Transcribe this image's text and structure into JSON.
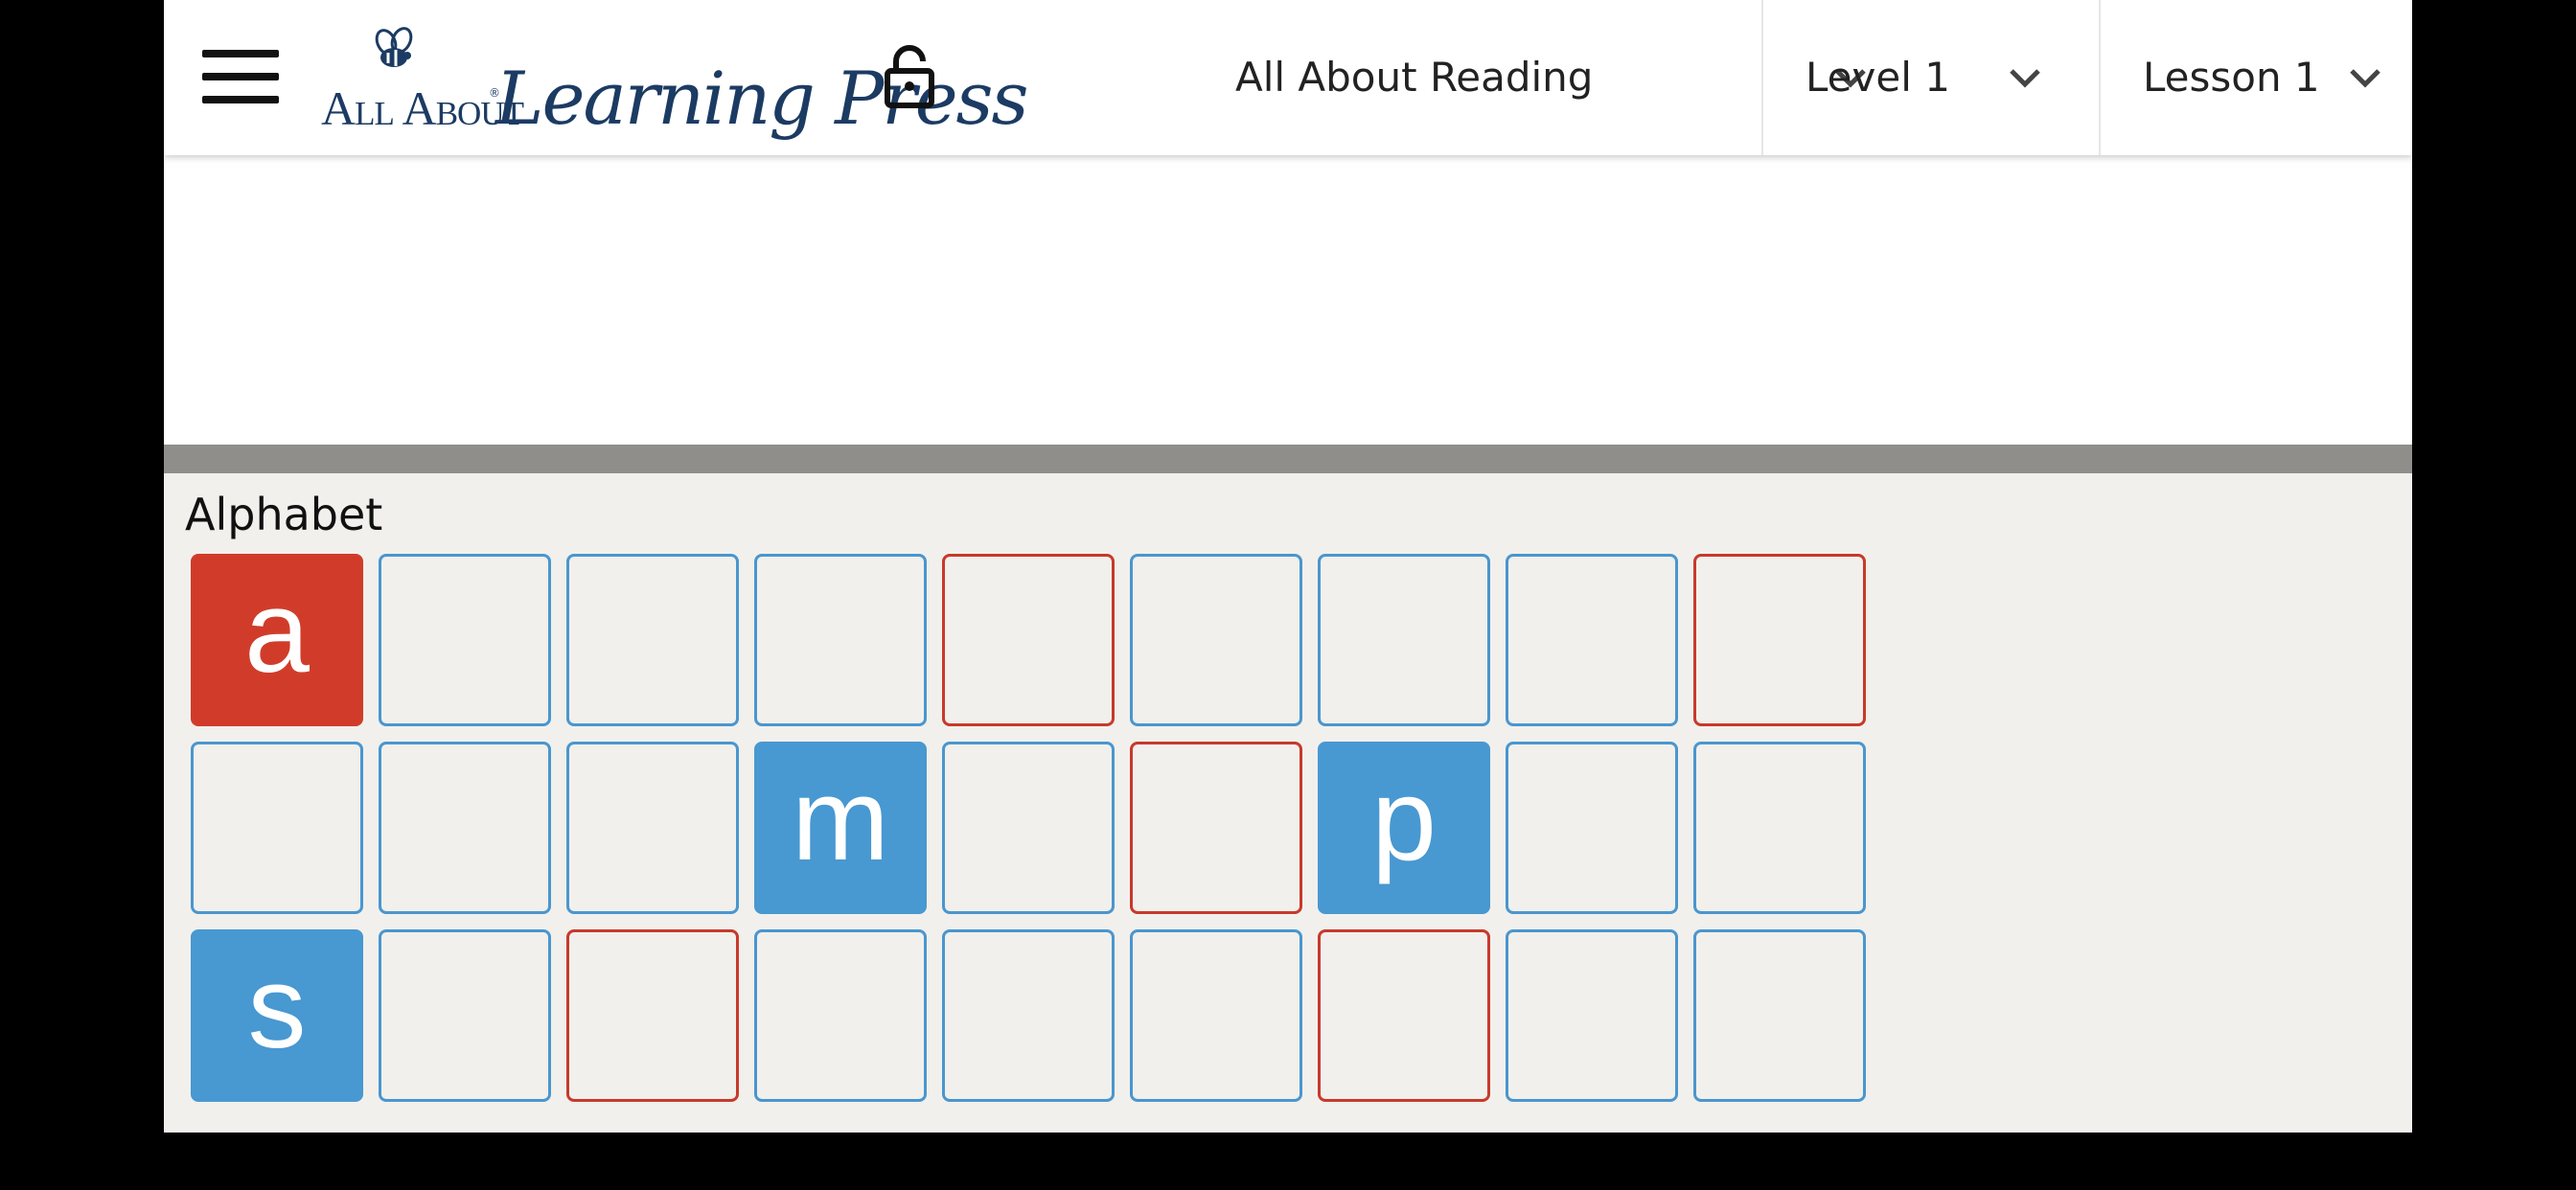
{
  "header": {
    "logo_text_small_caps": "All About",
    "logo_text_script": "Learning Press",
    "logo_registered": "®",
    "program": "All About Reading",
    "level": "Level 1",
    "lesson": "Lesson 1"
  },
  "alphabet": {
    "title": "Alphabet",
    "rows": [
      [
        {
          "letter": "a",
          "style": "filled-red"
        },
        {
          "letter": "",
          "style": "blue"
        },
        {
          "letter": "",
          "style": "blue"
        },
        {
          "letter": "",
          "style": "blue"
        },
        {
          "letter": "",
          "style": "red"
        },
        {
          "letter": "",
          "style": "blue"
        },
        {
          "letter": "",
          "style": "blue"
        },
        {
          "letter": "",
          "style": "blue"
        },
        {
          "letter": "",
          "style": "red"
        }
      ],
      [
        {
          "letter": "",
          "style": "blue"
        },
        {
          "letter": "",
          "style": "blue"
        },
        {
          "letter": "",
          "style": "blue"
        },
        {
          "letter": "m",
          "style": "filled-blue"
        },
        {
          "letter": "",
          "style": "blue"
        },
        {
          "letter": "",
          "style": "red"
        },
        {
          "letter": "p",
          "style": "filled-blue"
        },
        {
          "letter": "",
          "style": "blue"
        },
        {
          "letter": "",
          "style": "blue"
        }
      ],
      [
        {
          "letter": "s",
          "style": "filled-blue"
        },
        {
          "letter": "",
          "style": "blue"
        },
        {
          "letter": "",
          "style": "red"
        },
        {
          "letter": "",
          "style": "blue"
        },
        {
          "letter": "",
          "style": "blue"
        },
        {
          "letter": "",
          "style": "blue"
        },
        {
          "letter": "",
          "style": "red"
        },
        {
          "letter": "",
          "style": "blue"
        },
        {
          "letter": "",
          "style": "blue"
        }
      ]
    ]
  },
  "colors": {
    "vowel_red": "#d13c2a",
    "consonant_blue": "#4898d1",
    "brand_navy": "#1c3b63",
    "panel_bg": "#f1f0ec"
  },
  "icons": [
    "hamburger-menu-icon",
    "bee-icon",
    "lock-icon",
    "chevron-down-icon"
  ]
}
